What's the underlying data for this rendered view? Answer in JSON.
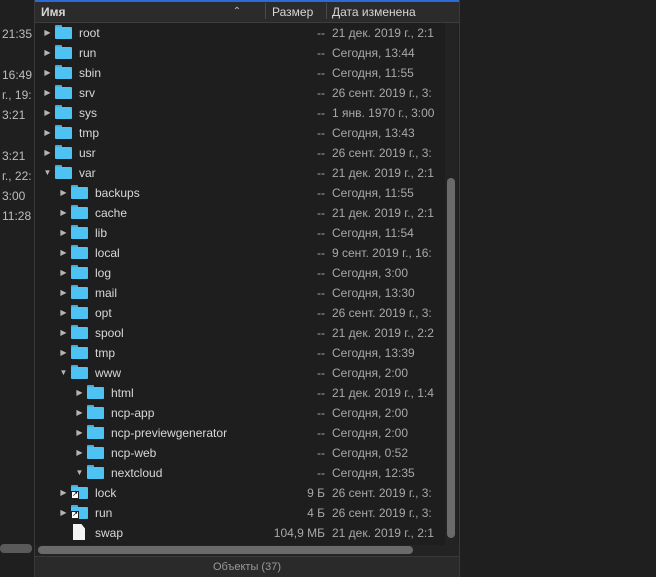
{
  "left_pane": {
    "fragments": [
      {
        "text": "21:35"
      },
      {
        "text": "16:49"
      },
      {
        "text": "г., 19:"
      },
      {
        "text": "3:21"
      },
      {
        "text": "3:21"
      },
      {
        "text": "г., 22:"
      },
      {
        "text": "3:00"
      },
      {
        "text": "11:28"
      }
    ]
  },
  "header": {
    "name": "Имя",
    "size": "Размер",
    "date": "Дата изменена"
  },
  "rows": [
    {
      "name": "root",
      "size": "--",
      "date": "21 дек. 2019 г., 2:1",
      "depth": 0,
      "expanded": false,
      "kind": "folder"
    },
    {
      "name": "run",
      "size": "--",
      "date": "Сегодня, 13:44",
      "depth": 0,
      "expanded": false,
      "kind": "folder"
    },
    {
      "name": "sbin",
      "size": "--",
      "date": "Сегодня, 11:55",
      "depth": 0,
      "expanded": false,
      "kind": "folder"
    },
    {
      "name": "srv",
      "size": "--",
      "date": "26 сент. 2019 г., 3:",
      "depth": 0,
      "expanded": false,
      "kind": "folder"
    },
    {
      "name": "sys",
      "size": "--",
      "date": "1 янв. 1970 г., 3:00",
      "depth": 0,
      "expanded": false,
      "kind": "folder"
    },
    {
      "name": "tmp",
      "size": "--",
      "date": "Сегодня, 13:43",
      "depth": 0,
      "expanded": false,
      "kind": "folder"
    },
    {
      "name": "usr",
      "size": "--",
      "date": "26 сент. 2019 г., 3:",
      "depth": 0,
      "expanded": false,
      "kind": "folder"
    },
    {
      "name": "var",
      "size": "--",
      "date": "21 дек. 2019 г., 2:1",
      "depth": 0,
      "expanded": true,
      "kind": "folder"
    },
    {
      "name": "backups",
      "size": "--",
      "date": "Сегодня, 11:55",
      "depth": 1,
      "expanded": false,
      "kind": "folder"
    },
    {
      "name": "cache",
      "size": "--",
      "date": "21 дек. 2019 г., 2:1",
      "depth": 1,
      "expanded": false,
      "kind": "folder"
    },
    {
      "name": "lib",
      "size": "--",
      "date": "Сегодня, 11:54",
      "depth": 1,
      "expanded": false,
      "kind": "folder"
    },
    {
      "name": "local",
      "size": "--",
      "date": "9 сент. 2019 г., 16:",
      "depth": 1,
      "expanded": false,
      "kind": "folder"
    },
    {
      "name": "log",
      "size": "--",
      "date": "Сегодня, 3:00",
      "depth": 1,
      "expanded": false,
      "kind": "folder"
    },
    {
      "name": "mail",
      "size": "--",
      "date": "Сегодня, 13:30",
      "depth": 1,
      "expanded": false,
      "kind": "folder"
    },
    {
      "name": "opt",
      "size": "--",
      "date": "26 сент. 2019 г., 3:",
      "depth": 1,
      "expanded": false,
      "kind": "folder"
    },
    {
      "name": "spool",
      "size": "--",
      "date": "21 дек. 2019 г., 2:2",
      "depth": 1,
      "expanded": false,
      "kind": "folder"
    },
    {
      "name": "tmp",
      "size": "--",
      "date": "Сегодня, 13:39",
      "depth": 1,
      "expanded": false,
      "kind": "folder"
    },
    {
      "name": "www",
      "size": "--",
      "date": "Сегодня, 2:00",
      "depth": 1,
      "expanded": true,
      "kind": "folder"
    },
    {
      "name": "html",
      "size": "--",
      "date": "21 дек. 2019 г., 1:4",
      "depth": 2,
      "expanded": false,
      "kind": "folder"
    },
    {
      "name": "ncp-app",
      "size": "--",
      "date": "Сегодня, 2:00",
      "depth": 2,
      "expanded": false,
      "kind": "folder"
    },
    {
      "name": "ncp-previewgenerator",
      "size": "--",
      "date": "Сегодня, 2:00",
      "depth": 2,
      "expanded": false,
      "kind": "folder"
    },
    {
      "name": "ncp-web",
      "size": "--",
      "date": "Сегодня, 0:52",
      "depth": 2,
      "expanded": false,
      "kind": "folder"
    },
    {
      "name": "nextcloud",
      "size": "--",
      "date": "Сегодня, 12:35",
      "depth": 2,
      "expanded": true,
      "kind": "folder"
    },
    {
      "name": "lock",
      "size": "9 Б",
      "date": "26 сент. 2019 г., 3:",
      "depth": 1,
      "expanded": false,
      "kind": "link"
    },
    {
      "name": "run",
      "size": "4 Б",
      "date": "26 сент. 2019 г., 3:",
      "depth": 1,
      "expanded": false,
      "kind": "link"
    },
    {
      "name": "swap",
      "size": "104,9 МБ",
      "date": "21 дек. 2019 г., 2:1",
      "depth": 1,
      "expanded": false,
      "kind": "file"
    }
  ],
  "status": "Объекты (37)",
  "colors": {
    "folder": "#4ec2f2",
    "accent": "#2d6ad6",
    "background": "#1e1e1e"
  },
  "icons": {
    "collapsed": "disclosure-right-icon",
    "expanded": "disclosure-down-icon",
    "folder": "folder-icon",
    "link": "folder-alias-icon",
    "file": "document-icon",
    "sort": "chevron-up-icon"
  }
}
